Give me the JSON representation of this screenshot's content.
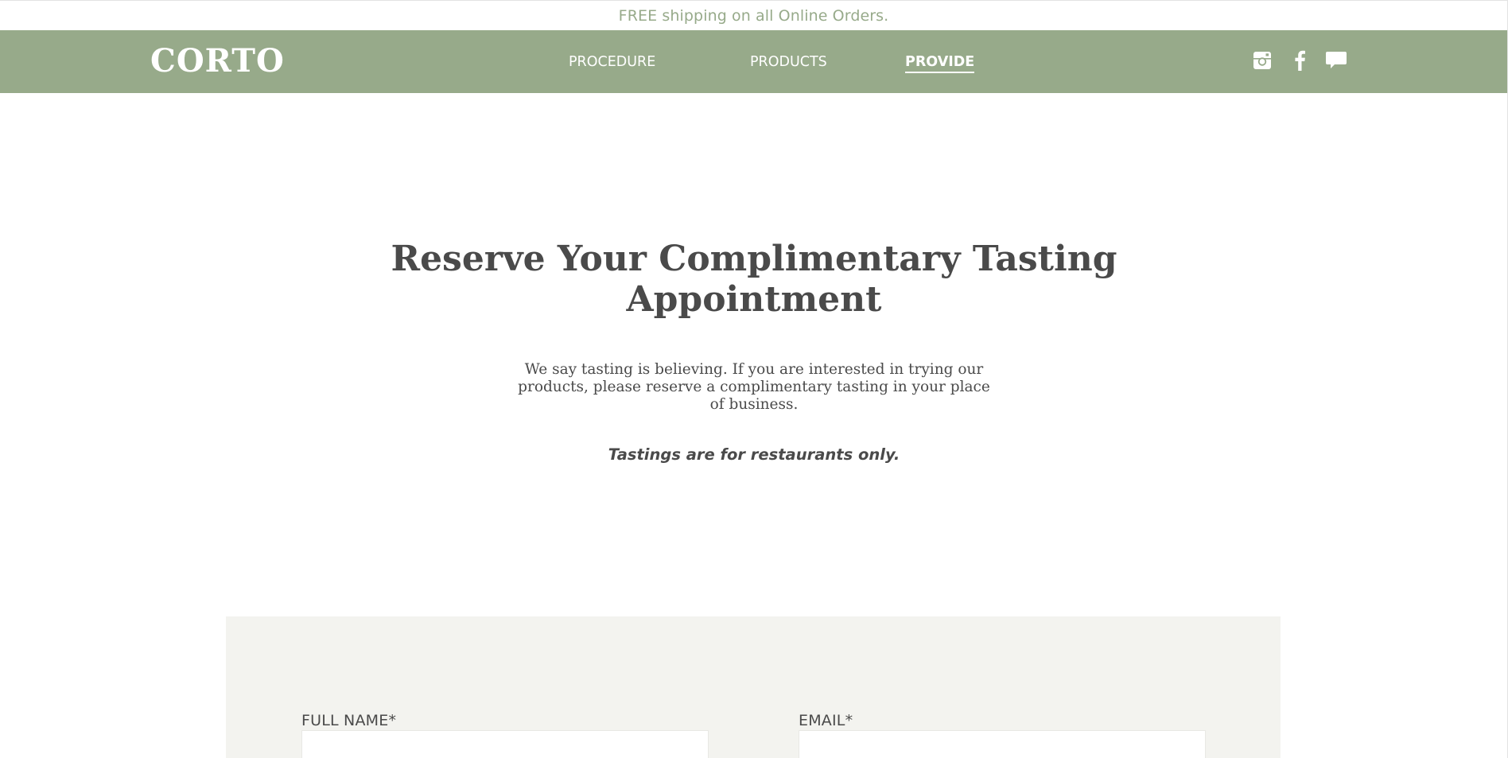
{
  "promo": {
    "text": "FREE shipping on all Online Orders."
  },
  "header": {
    "logo": "CORTO",
    "nav": [
      {
        "label": "PROCEDURE",
        "active": false
      },
      {
        "label": "PRODUCTS",
        "active": false
      },
      {
        "label": "PROVIDE",
        "active": true
      }
    ],
    "social_icons": [
      "instagram-icon",
      "facebook-icon",
      "chat-icon"
    ]
  },
  "main": {
    "title": "Reserve Your Complimentary Tasting Appointment",
    "intro": "We say tasting is believing. If you are interested in trying our products, please reserve a complimentary tasting in your place of business.",
    "note": "Tastings are for restaurants only."
  },
  "form": {
    "full_name_label": "FULL NAME*",
    "full_name_value": "",
    "email_label": "EMAIL*",
    "email_value": ""
  },
  "colors": {
    "brand_green": "#97aa8a",
    "text_dark": "#4a4a4a",
    "form_background": "#f3f3ef"
  }
}
